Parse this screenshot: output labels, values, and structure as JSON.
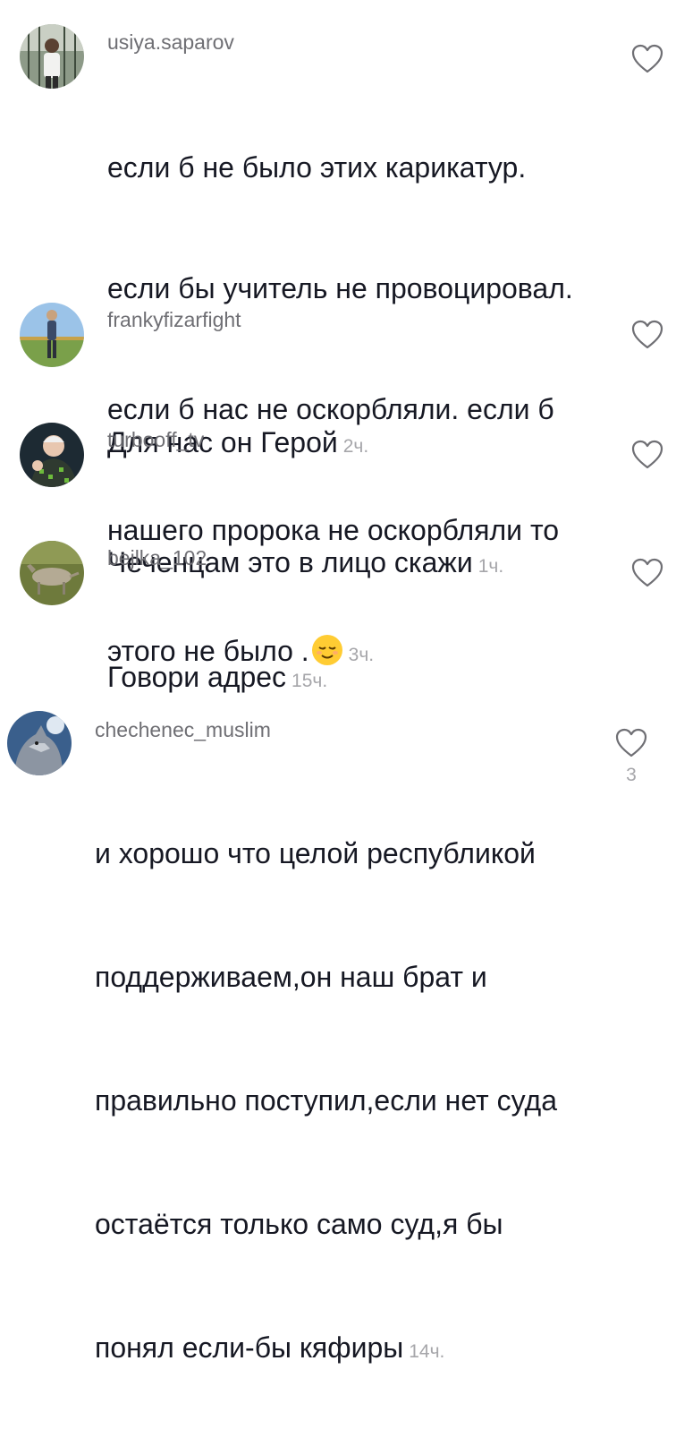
{
  "comments": [
    {
      "username": "usiya.saparov",
      "lines": [
        "если б не было этих карикатур.",
        "если бы учитель не провоцировал.",
        "если б нас не оскорбляли. если б",
        "нашего пророка не оскорбляли то",
        "этого не было ."
      ],
      "emoji": "relieved-face",
      "time": "3ч."
    },
    {
      "username": "frankyfizarfight",
      "lines": [
        "Для нас он Герой"
      ],
      "time": "2ч."
    },
    {
      "username": "turbooff_tv",
      "lines": [
        "Чеченцам это в лицо скажи"
      ],
      "time": "1ч."
    },
    {
      "username": "bejlka_102",
      "lines": [
        "Говори адрес"
      ],
      "time": "15ч."
    },
    {
      "username": "chechenec_muslim",
      "lines": [
        "и хорошо что целой республикой",
        "поддерживаем,он наш брат и",
        "правильно поступил,если нет суда",
        "остаётся только само суд,я бы",
        "понял если-бы кяфиры"
      ],
      "time": "14ч.",
      "likes": "3"
    }
  ],
  "icons": {
    "like": "heart-outline-icon",
    "emoji": "relieved-face"
  },
  "colors": {
    "text": "#161823",
    "username": "#6f6f74",
    "meta": "#a6a6aa"
  }
}
